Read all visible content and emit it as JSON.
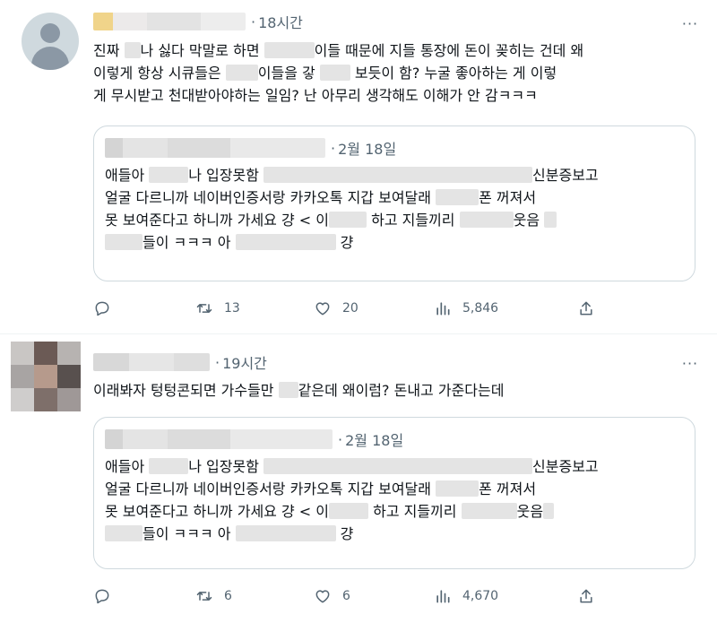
{
  "tweets": [
    {
      "time": "18시간",
      "separator": "·",
      "more": "···",
      "text_lines": [
        [
          "진짜 ",
          "",
          "나 싫다 막말로 하면 ",
          "",
          "이들 때문에 지들 통장에 돈이 꽂히는 건데 왜"
        ],
        [
          "이렇게 항상 시큐들은 ",
          "",
          "이들을 갛 ",
          "",
          " 보듯이 함? 누굴 좋아하는 게 이렇"
        ],
        [
          "게 무시받고 천대받아야하는 일임? 난 아무리 생각해도 이해가 안 감ㅋㅋㅋ"
        ]
      ],
      "quote": {
        "date": "2월 18일",
        "separator": "·",
        "lines": [
          [
            "애들아 ",
            "",
            "나 입장못함 ",
            "",
            "신분증보고"
          ],
          [
            "얼굴 다르니까 네이버인증서랑 카카오톡 지갑 보여달래 ",
            "",
            "폰 꺼져서"
          ],
          [
            "못 보여준다고 하니까 가세요 걍 < 이",
            "",
            " 하고 지들끼리 ",
            "",
            "웃음 ",
            ""
          ],
          [
            "",
            "들이 ㅋㅋㅋ 아 ",
            "",
            " 걍"
          ]
        ]
      },
      "actions": {
        "reply": "",
        "retweet": "13",
        "like": "20",
        "views": "5,846",
        "share": ""
      }
    },
    {
      "time": "19시간",
      "separator": "·",
      "more": "···",
      "text_lines": [
        [
          "이래봐자 텅텅콘되면 가수들만 ",
          "",
          "같은데 왜이럼? 돈내고 가준다는데"
        ]
      ],
      "quote": {
        "date": "2월 18일",
        "separator": "·",
        "lines": [
          [
            "애들아 ",
            "",
            "나 입장못함 ",
            "",
            "신분증보고"
          ],
          [
            "얼굴 다르니까 네이버인증서랑 카카오톡 지갑 보여달래 ",
            "",
            "폰 꺼져서"
          ],
          [
            "못 보여준다고 하니까 가세요 걍 < 이",
            "",
            " 하고 지들끼리 ",
            "",
            "웃음",
            ""
          ],
          [
            "",
            "들이 ㅋㅋㅋ 아 ",
            "",
            " 걍"
          ]
        ]
      },
      "actions": {
        "reply": "",
        "retweet": "6",
        "like": "6",
        "views": "4,670",
        "share": ""
      }
    }
  ],
  "icons": {
    "reply": "reply-icon",
    "retweet": "retweet-icon",
    "like": "like-icon",
    "views": "views-icon",
    "share": "share-icon",
    "more": "more-icon"
  },
  "colors": {
    "text": "#0f1419",
    "secondary": "#536471",
    "border": "#cfd9de",
    "divider": "#eff3f4"
  }
}
